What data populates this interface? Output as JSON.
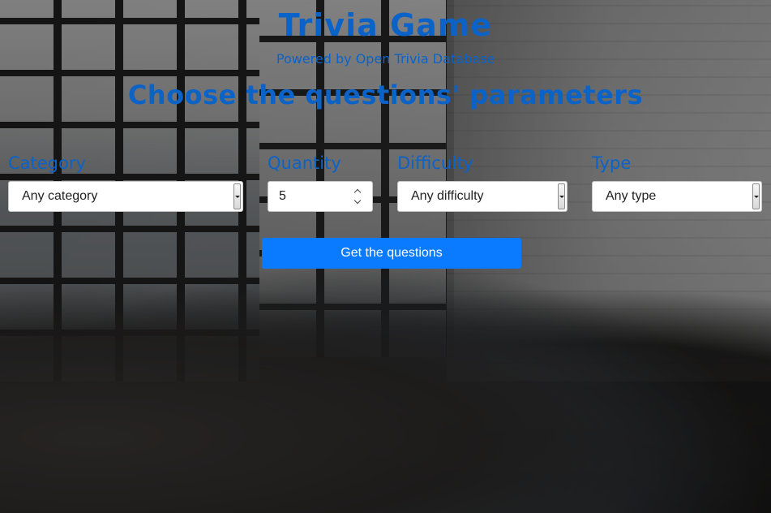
{
  "header": {
    "title": "Trivia Game",
    "subtitle": "Powered by Open Trivia Database",
    "heading": "Choose the questions' parameters"
  },
  "form": {
    "category": {
      "label": "Category",
      "selected": "Any category"
    },
    "quantity": {
      "label": "Quantity",
      "value": "5"
    },
    "difficulty": {
      "label": "Difficulty",
      "selected": "Any difficulty"
    },
    "type": {
      "label": "Type",
      "selected": "Any type"
    },
    "submit_label": "Get the questions"
  },
  "colors": {
    "accent_text": "#0b63c8",
    "button_bg": "#0a7bff",
    "button_text": "#ffffff"
  },
  "icons": {
    "select_arrow": "chevron-down-icon",
    "number_spinner": "up-down-stepper-icon"
  }
}
